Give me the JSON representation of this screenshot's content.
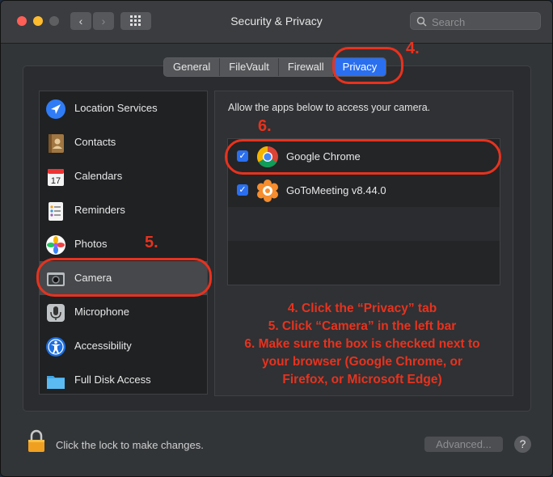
{
  "window": {
    "title": "Security & Privacy",
    "search_placeholder": "Search",
    "nav_back": "‹",
    "nav_forward": "›"
  },
  "tabs": [
    {
      "label": "General"
    },
    {
      "label": "FileVault"
    },
    {
      "label": "Firewall"
    },
    {
      "label": "Privacy",
      "active": true
    }
  ],
  "sidebar": {
    "items": [
      {
        "label": "Location Services",
        "icon": "location-arrow-icon"
      },
      {
        "label": "Contacts",
        "icon": "contacts-book-icon"
      },
      {
        "label": "Calendars",
        "icon": "calendar-icon"
      },
      {
        "label": "Reminders",
        "icon": "reminders-list-icon"
      },
      {
        "label": "Photos",
        "icon": "photos-pinwheel-icon"
      },
      {
        "label": "Camera",
        "icon": "camera-icon",
        "selected": true
      },
      {
        "label": "Microphone",
        "icon": "microphone-icon"
      },
      {
        "label": "Accessibility",
        "icon": "accessibility-icon"
      },
      {
        "label": "Full Disk Access",
        "icon": "folder-icon"
      }
    ]
  },
  "main": {
    "instruction": "Allow the apps below to access your camera.",
    "apps": [
      {
        "label": "Google Chrome",
        "checked": true,
        "icon": "chrome-icon"
      },
      {
        "label": "GoToMeeting v8.44.0",
        "checked": true,
        "icon": "gotomeeting-icon"
      }
    ],
    "checkmark": "✓"
  },
  "annotations": {
    "step4": "4.",
    "step5": "5.",
    "step6": "6.",
    "text_line1": "4. Click the “Privacy” tab",
    "text_line2": "5. Click “Camera” in the left bar",
    "text_line3": "6. Make sure the box is checked next to",
    "text_line4": "your browser (Google Chrome, or",
    "text_line5": "Firefox, or Microsoft Edge)"
  },
  "footer": {
    "lock_text": "Click the lock to make changes.",
    "advanced_label": "Advanced...",
    "help_label": "?"
  },
  "colors": {
    "accent": "#2a6ff0",
    "annotation": "#e8321e"
  }
}
